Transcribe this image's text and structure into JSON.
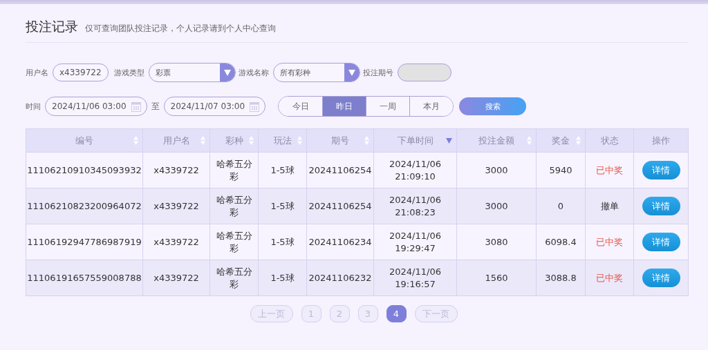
{
  "header": {
    "title": "投注记录",
    "subtitle": "仅可查询团队投注记录，个人记录请到个人中心查询"
  },
  "filters": {
    "username": {
      "label": "用户名",
      "value": "x4339722"
    },
    "game_type": {
      "label": "游戏类型",
      "value": "彩票"
    },
    "game_name": {
      "label": "游戏名称",
      "value": "所有彩种"
    },
    "issue": {
      "label": "投注期号",
      "disabled": true
    },
    "time": {
      "label": "时间",
      "from": "2024/11/06 03:00",
      "separator": "至",
      "to": "2024/11/07 03:00"
    },
    "ranges": [
      {
        "label": "今日",
        "selected": false
      },
      {
        "label": "昨日",
        "selected": true
      },
      {
        "label": "一周",
        "selected": false
      },
      {
        "label": "本月",
        "selected": false
      }
    ],
    "search_button": "搜索"
  },
  "table": {
    "columns": [
      {
        "label": "编号",
        "kind": "sortable"
      },
      {
        "label": "用户名",
        "kind": "sortable"
      },
      {
        "label": "彩种",
        "kind": "sortable"
      },
      {
        "label": "玩法",
        "kind": "sortable"
      },
      {
        "label": "期号",
        "kind": "sortable"
      },
      {
        "label": "下单时间",
        "kind": "descending"
      },
      {
        "label": "投注金额",
        "kind": "sortable"
      },
      {
        "label": "奖金",
        "kind": "sortable"
      },
      {
        "label": "状态",
        "kind": "plain"
      },
      {
        "label": "操作",
        "kind": "plain"
      }
    ],
    "rows": [
      {
        "id": "11106210910345093932",
        "user": "x4339722",
        "lottery": "哈希五分彩",
        "play": "1-5球",
        "issue": "20241106254",
        "date": "2024/11/06",
        "time": "21:09:10",
        "amount": "3000",
        "prize": "5940",
        "status": "已中奖",
        "kind": "won",
        "action": "详情"
      },
      {
        "id": "11106210823200964072",
        "user": "x4339722",
        "lottery": "哈希五分彩",
        "play": "1-5球",
        "issue": "20241106254",
        "date": "2024/11/06",
        "time": "21:08:23",
        "amount": "3000",
        "prize": "0",
        "status": "撤单",
        "kind": "cancelled",
        "action": "详情"
      },
      {
        "id": "11106192947786987919",
        "user": "x4339722",
        "lottery": "哈希五分彩",
        "play": "1-5球",
        "issue": "20241106234",
        "date": "2024/11/06",
        "time": "19:29:47",
        "amount": "3080",
        "prize": "6098.4",
        "status": "已中奖",
        "kind": "won",
        "action": "详情"
      },
      {
        "id": "11106191657559008788",
        "user": "x4339722",
        "lottery": "哈希五分彩",
        "play": "1-5球",
        "issue": "20241106232",
        "date": "2024/11/06",
        "time": "19:16:57",
        "amount": "1560",
        "prize": "3088.8",
        "status": "已中奖",
        "kind": "won",
        "action": "详情"
      }
    ]
  },
  "pagination": {
    "prev": {
      "label": "上一页",
      "disabled": true
    },
    "pages": [
      {
        "label": "1",
        "selected": false
      },
      {
        "label": "2",
        "selected": false
      },
      {
        "label": "3",
        "selected": false
      },
      {
        "label": "4",
        "selected": true
      }
    ],
    "next": {
      "label": "下一页",
      "disabled": true
    }
  }
}
